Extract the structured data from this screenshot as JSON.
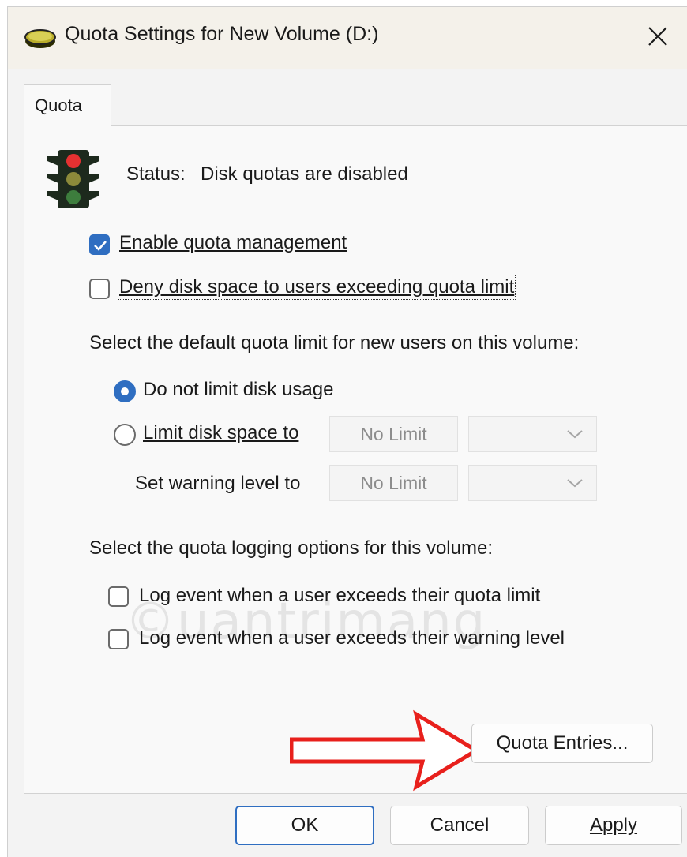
{
  "window": {
    "title": "Quota Settings for New Volume (D:)",
    "icon": "disk-drive-icon",
    "close_icon": "close-icon"
  },
  "tabs": [
    {
      "label": "Quota",
      "active": true
    }
  ],
  "status": {
    "label": "Status:",
    "value": "Disk quotas are disabled",
    "icon": "traffic-light-icon"
  },
  "options": {
    "enable_quota": {
      "label": "Enable quota management",
      "checked": true
    },
    "deny_space": {
      "label": "Deny disk space to users exceeding quota limit",
      "checked": false
    }
  },
  "default_limit": {
    "heading": "Select the default quota limit for new users on this volume:",
    "no_limit": {
      "label": "Do not limit disk usage",
      "selected": true
    },
    "limit_to": {
      "label": "Limit disk space to",
      "selected": false,
      "value": "No Limit",
      "unit": ""
    },
    "warning": {
      "label": "Set warning level to",
      "value": "No Limit",
      "unit": ""
    }
  },
  "logging": {
    "heading": "Select the quota logging options for this volume:",
    "log_limit": {
      "label": "Log event when a user exceeds their quota limit",
      "checked": false
    },
    "log_warning": {
      "label": "Log event when a user exceeds their warning level",
      "checked": false
    }
  },
  "buttons": {
    "quota_entries": "Quota Entries...",
    "ok": "OK",
    "cancel": "Cancel",
    "apply": "Apply"
  },
  "colors": {
    "accent": "#2f6ec1",
    "annotation_arrow": "#e8201c",
    "titlebar": "#f4f1ea"
  }
}
